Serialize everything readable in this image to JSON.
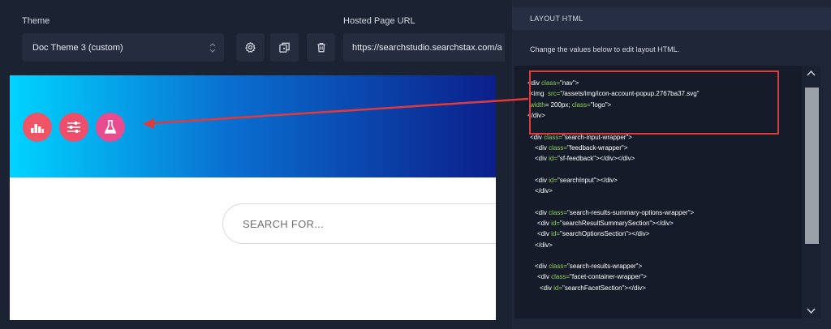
{
  "left_panel": {
    "theme_label": "Theme",
    "theme_select_value": "Doc Theme 3 (custom)",
    "url_label": "Hosted Page URL",
    "url_value": "https://searchstudio.searchstax.com/a",
    "icons": {
      "gear": "gear-icon",
      "copy": "copy-icon",
      "trash": "trash-icon",
      "chevron": "chevron-updown-icon"
    },
    "preview": {
      "banner_icons": [
        "bar-chart-icon",
        "sliders-icon",
        "flask-icon"
      ],
      "search_placeholder": "SEARCH FOR..."
    }
  },
  "right_panel": {
    "title": "LAYOUT HTML",
    "subtitle": "Change the values below to edit layout HTML.",
    "code_lines": [
      {
        "indent": 4,
        "parts": [
          [
            "tag",
            "<div "
          ],
          [
            "attr",
            "class="
          ],
          [
            "str",
            "\"nav\">"
          ]
        ]
      },
      {
        "indent": 5,
        "parts": [
          [
            "tag",
            "<img  "
          ],
          [
            "attr",
            "src="
          ],
          [
            "str",
            "\"/assets/img/icon-account-popup.2767ba37.svg\""
          ]
        ]
      },
      {
        "indent": 5,
        "parts": [
          [
            "attr",
            "width"
          ],
          [
            "str",
            "= 200px; "
          ],
          [
            "attr",
            "class="
          ],
          [
            "str",
            "\"logo\">"
          ]
        ]
      },
      {
        "indent": 4,
        "parts": [
          [
            "tag",
            "</div>"
          ]
        ]
      },
      {
        "indent": 0,
        "parts": []
      },
      {
        "indent": 5,
        "parts": [
          [
            "tag",
            "<div "
          ],
          [
            "attr",
            "class="
          ],
          [
            "str",
            "\"search-input-wrapper\">"
          ]
        ]
      },
      {
        "indent": 7,
        "parts": [
          [
            "tag",
            "<div "
          ],
          [
            "attr",
            "class="
          ],
          [
            "str",
            "\"feedback-wrapper\">"
          ]
        ]
      },
      {
        "indent": 7,
        "parts": [
          [
            "tag",
            "<div "
          ],
          [
            "attr",
            "id="
          ],
          [
            "str",
            "\"sf-feedback\"></div></div>"
          ]
        ]
      },
      {
        "indent": 0,
        "parts": []
      },
      {
        "indent": 7,
        "parts": [
          [
            "tag",
            "<div "
          ],
          [
            "attr",
            "id="
          ],
          [
            "str",
            "\"searchInput\"></div>"
          ]
        ]
      },
      {
        "indent": 7,
        "parts": [
          [
            "tag",
            "</div>"
          ]
        ]
      },
      {
        "indent": 0,
        "parts": []
      },
      {
        "indent": 7,
        "parts": [
          [
            "tag",
            "<div "
          ],
          [
            "attr",
            "class="
          ],
          [
            "str",
            "\"search-results-summary-options-wrapper\">"
          ]
        ]
      },
      {
        "indent": 8,
        "parts": [
          [
            "tag",
            "<div "
          ],
          [
            "attr",
            "id="
          ],
          [
            "str",
            "\"searchResultSummarySection\"></div>"
          ]
        ]
      },
      {
        "indent": 8,
        "parts": [
          [
            "tag",
            "<div "
          ],
          [
            "attr",
            "id="
          ],
          [
            "str",
            "\"searchOptionsSection\"></div>"
          ]
        ]
      },
      {
        "indent": 7,
        "parts": [
          [
            "tag",
            "</div>"
          ]
        ]
      },
      {
        "indent": 0,
        "parts": []
      },
      {
        "indent": 7,
        "parts": [
          [
            "tag",
            "<div "
          ],
          [
            "attr",
            "class="
          ],
          [
            "str",
            "\"search-results-wrapper\">"
          ]
        ]
      },
      {
        "indent": 8,
        "parts": [
          [
            "tag",
            "<div "
          ],
          [
            "attr",
            "class="
          ],
          [
            "str",
            "\"facet-container-wrapper\">"
          ]
        ]
      },
      {
        "indent": 9,
        "parts": [
          [
            "tag",
            "<div "
          ],
          [
            "attr",
            "id="
          ],
          [
            "str",
            "\"searchFacetSection\"></div>"
          ]
        ]
      }
    ]
  },
  "colors": {
    "annotation": "#e13a3a",
    "attr_green": "#8dd05a"
  }
}
